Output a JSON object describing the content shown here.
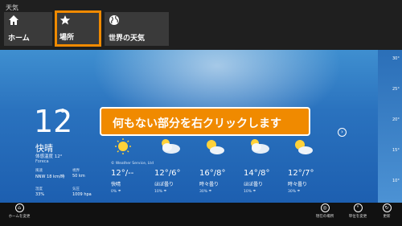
{
  "app": {
    "title": "天気"
  },
  "nav": {
    "items": [
      {
        "label": "ホーム",
        "icon": "home-icon"
      },
      {
        "label": "場所",
        "icon": "star-icon",
        "selected": true
      },
      {
        "label": "世界の天気",
        "icon": "globe-icon"
      }
    ],
    "highlight_color": "#f08a00"
  },
  "current": {
    "temperature": "12",
    "degree": "°",
    "condition": "快晴",
    "feels_like": "体感温度 12°",
    "provider": "Foreca",
    "stats": [
      {
        "label": "風速",
        "value": "NNW 18 km/時"
      },
      {
        "label": "視界",
        "value": "50 km"
      },
      {
        "label": "湿度",
        "value": "33%"
      },
      {
        "label": "気圧",
        "value": "1009 hpa"
      }
    ]
  },
  "forecast": [
    {
      "temp": "12°/--",
      "condition": "快晴",
      "rain": "0% ☂",
      "icon": "sun-icon"
    },
    {
      "temp": "12°/6°",
      "condition": "ほぼ曇り",
      "rain": "10% ☂",
      "icon": "cloudy-icon"
    },
    {
      "temp": "16°/8°",
      "condition": "時々曇り",
      "rain": "30% ☂",
      "icon": "partly-cloudy-icon"
    },
    {
      "temp": "14°/8°",
      "condition": "ほぼ曇り",
      "rain": "10% ☂",
      "icon": "cloudy-icon"
    },
    {
      "temp": "12°/7°",
      "condition": "時々曇り",
      "rain": "30% ☂",
      "icon": "partly-cloudy-icon"
    }
  ],
  "copyright": "© Weather Service, Ltd",
  "callout": {
    "text": "何もない部分を右クリックします"
  },
  "scale": {
    "ticks": [
      "30°",
      "25°",
      "20°",
      "15°",
      "10°"
    ]
  },
  "appbar": {
    "left": {
      "label": "ホームを変更"
    },
    "right": [
      {
        "label": "現在の場所",
        "icon": "location-icon"
      },
      {
        "label": "単位を変更",
        "icon": "units-icon"
      },
      {
        "label": "更新",
        "icon": "refresh-icon"
      }
    ]
  },
  "colors": {
    "accent": "#f08a00",
    "sky": "#2a72be",
    "bar": "#111111"
  }
}
